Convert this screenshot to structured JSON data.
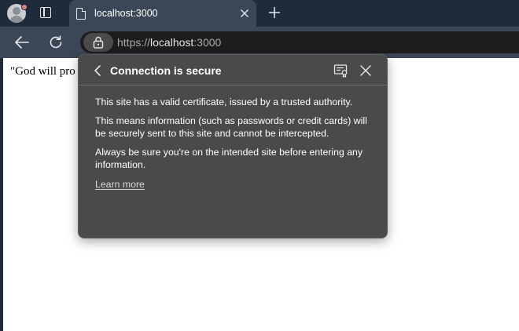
{
  "tab": {
    "title": "localhost:3000",
    "close_icon": "close-icon"
  },
  "toolbar": {
    "url_scheme": "https://",
    "url_host": "localhost",
    "url_port": ":3000"
  },
  "page": {
    "text": "\"God will pro"
  },
  "popup": {
    "title": "Connection is secure",
    "paragraphs": [
      "This site has a valid certificate, issued by a trusted authority.",
      "This means information (such as passwords or credit cards) will be securely sent to this site and cannot be intercepted.",
      "Always be sure you're on the intended site before entering any information."
    ],
    "learn_more": "Learn more"
  },
  "colors": {
    "tabstrip": "#1f2b3a",
    "toolbar": "#3b4757",
    "popup_bg": "#4a4a4a",
    "address_bg": "#1d1d1f"
  }
}
